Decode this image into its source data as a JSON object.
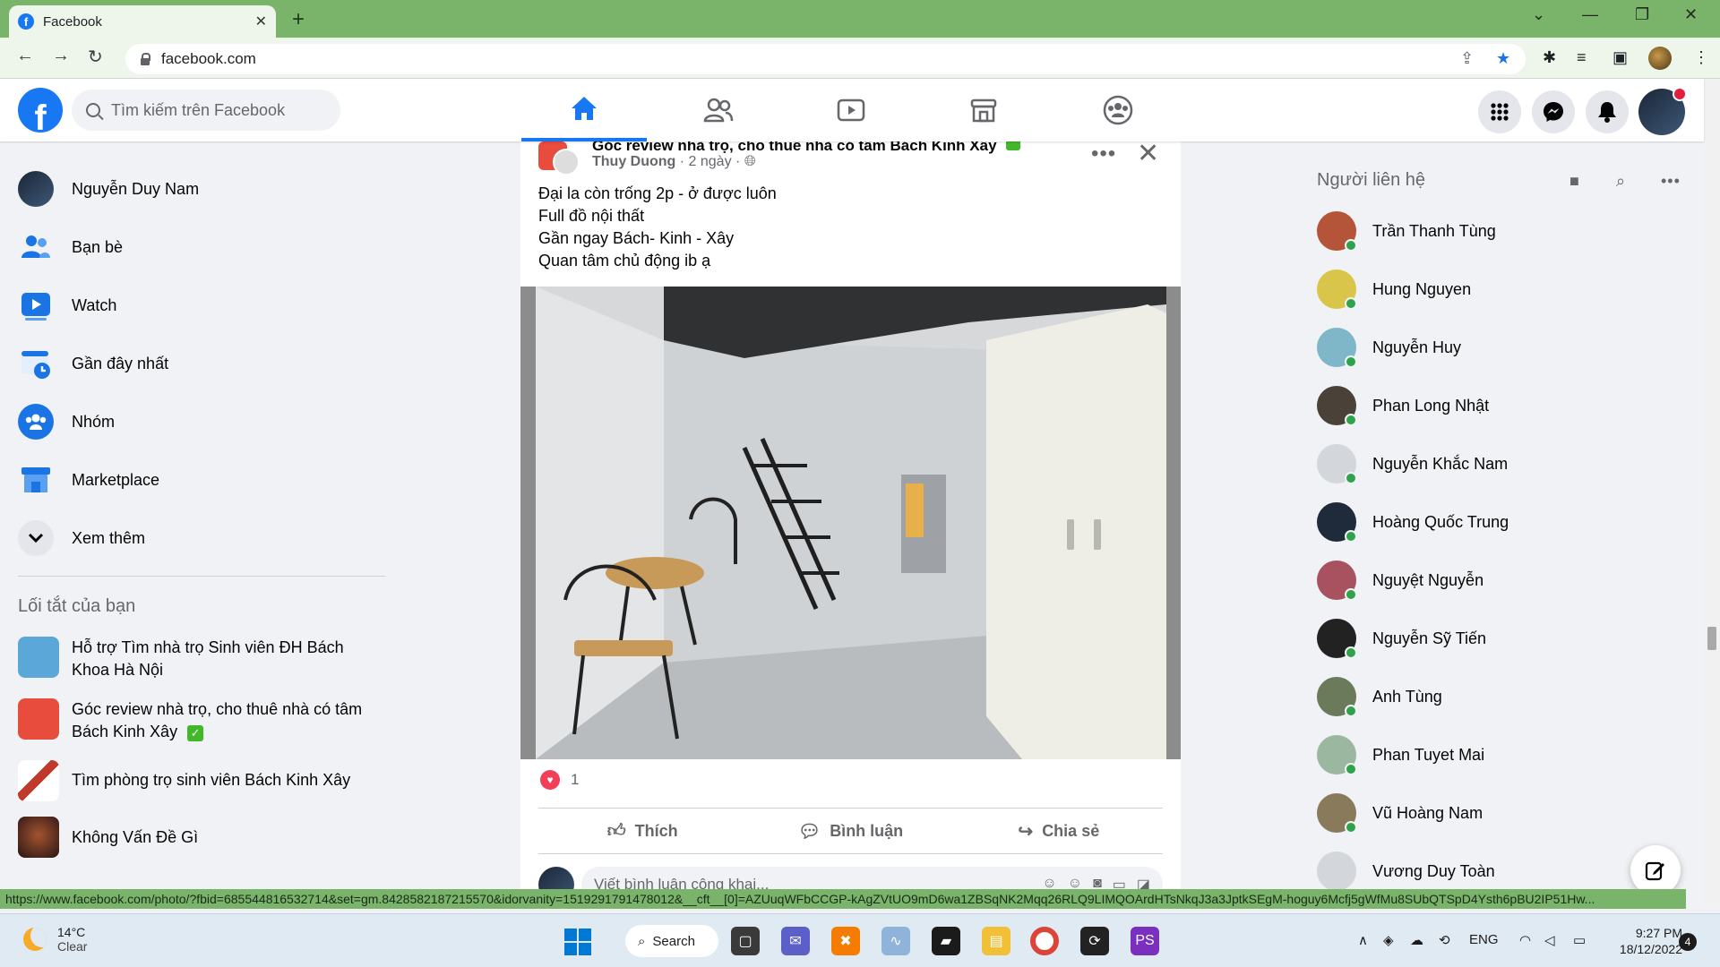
{
  "browser": {
    "tab_title": "Facebook",
    "tab_close": "✕",
    "new_tab": "+",
    "url": "facebook.com",
    "status_url": "https://www.facebook.com/photo/?fbid=685544816532714&set=gm.842858218721557​0&idorvanity=1519291791478012&__cft__[0]=AZUuqWFbCCGP-kAgZVtUO9mD6wa1ZBSqNK2Mqq26RLQ9LIMQOArdHTsNkqJ3a3JptkSEgM-hoguy6Mcfj5gWfMu8SUbQTSpD4Ysth6pBU2IP51Hw..."
  },
  "fb": {
    "logo": "f",
    "search_placeholder": "Tìm kiếm trên Facebook"
  },
  "left_nav": {
    "items": [
      {
        "label": "Nguyễn Duy Nam",
        "icon": "profile-avatar"
      },
      {
        "label": "Bạn bè",
        "icon": "friends-icon"
      },
      {
        "label": "Watch",
        "icon": "watch-icon"
      },
      {
        "label": "Gần đây nhất",
        "icon": "recent-icon"
      },
      {
        "label": "Nhóm",
        "icon": "groups-icon"
      },
      {
        "label": "Marketplace",
        "icon": "marketplace-icon"
      },
      {
        "label": "Xem thêm",
        "icon": "chevron-down-icon"
      }
    ],
    "shortcuts_title": "Lối tắt của bạn",
    "shortcuts": [
      {
        "label": "Hỗ trợ Tìm nhà trọ Sinh viên ĐH Bách Khoa Hà Nội",
        "color": "#5aa7d8"
      },
      {
        "label": "Góc review nhà trọ, cho thuê nhà có tâm Bách Kinh Xây",
        "verified": "✓",
        "color": "#e74c3c"
      },
      {
        "label": "Tìm phòng trọ sinh viên Bách Kinh Xây",
        "color": "#c0392b"
      },
      {
        "label": "Không Vấn Đề Gì",
        "color": "#3b1f1f"
      }
    ]
  },
  "post": {
    "group_name": "Góc review nhà trọ, cho thuê nhà có tâm Bách Kinh Xây",
    "author": "Thuy Duong",
    "time": "· 2 ngày ·",
    "text_lines": [
      "Đại la còn trống 2p - ở được luôn",
      "Full đồ nội thất",
      "Gần ngay Bách- Kinh - Xây",
      "Quan tâm chủ động ib ạ"
    ],
    "reaction_count": "1",
    "actions": {
      "like": "Thích",
      "comment": "Bình luận",
      "share": "Chia sẻ"
    },
    "comment_placeholder": "Viết bình luận công khai..."
  },
  "contacts": {
    "title": "Người liên hệ",
    "people": [
      {
        "name": "Trần Thanh Tùng",
        "color": "#b4553a",
        "online": true
      },
      {
        "name": "Hung Nguyen",
        "color": "#d8c54a",
        "online": true
      },
      {
        "name": "Nguyễn Huy",
        "color": "#7fb7c9",
        "online": true
      },
      {
        "name": "Phan Long Nhật",
        "color": "#4a4238",
        "online": true
      },
      {
        "name": "Nguyễn Khắc Nam",
        "color": "#d3d6da",
        "online": true
      },
      {
        "name": "Hoàng Quốc Trung",
        "color": "#1f2a3a",
        "online": true
      },
      {
        "name": "Nguyệt Nguyễn",
        "color": "#a7525e",
        "online": true
      },
      {
        "name": "Nguyễn Sỹ Tiến",
        "color": "#222222",
        "online": true
      },
      {
        "name": "Anh Tùng",
        "color": "#6b7a5a",
        "online": true
      },
      {
        "name": "Phan Tuyet Mai",
        "color": "#9bb7a0",
        "online": true
      },
      {
        "name": "Vũ Hoàng Nam",
        "color": "#8a7a5c",
        "online": true
      },
      {
        "name": "Vương Duy Toàn",
        "color": "#d3d6da",
        "online": false
      }
    ]
  },
  "taskbar": {
    "temp": "14°C",
    "weather": "Clear",
    "search": "Search",
    "lang": "ENG",
    "time": "9:27 PM",
    "date": "18/12/2022",
    "notif": "4"
  },
  "colors": {
    "fb_blue": "#1877f2",
    "chrome_green": "#7ab36a"
  }
}
